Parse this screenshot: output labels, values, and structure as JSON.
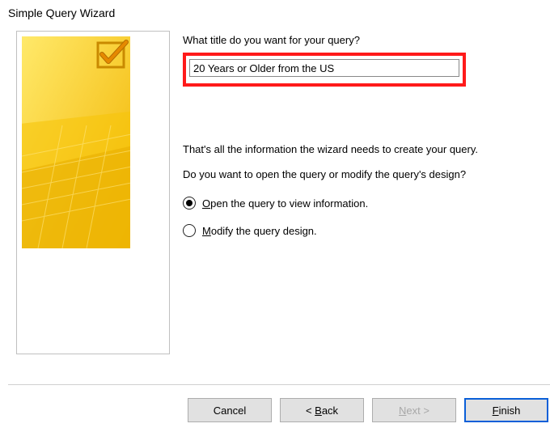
{
  "title": "Simple Query Wizard",
  "prompt": "What title do you want for your query?",
  "input_value": "20 Years or Older from the US",
  "info_line1": "That's all the information the wizard needs to create your query.",
  "info_line2": "Do you want to open the query or modify the query's design?",
  "radio_open": "Open the query to view information.",
  "radio_modify": "Modify the query design.",
  "buttons": {
    "cancel": "Cancel",
    "back_prefix": "< ",
    "back_u": "B",
    "back_rest": "ack",
    "next_u": "N",
    "next_rest": "ext >",
    "finish_u": "F",
    "finish_rest": "inish"
  },
  "accent": "#0a5fd8",
  "highlight": "#ff1a1a"
}
